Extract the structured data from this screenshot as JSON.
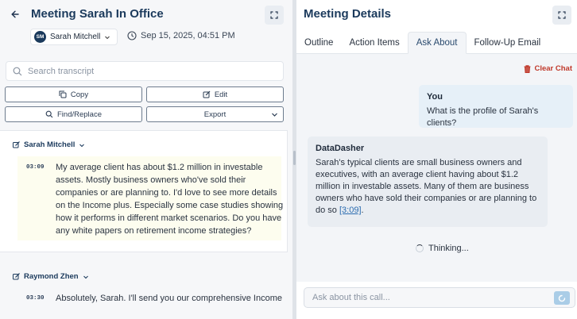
{
  "left": {
    "title": "Meeting Sarah In Office",
    "speaker_initials": "SM",
    "speaker_name": "Sarah Mitchell",
    "date": "Sep 15, 2025, 04:51 PM",
    "search_placeholder": "Search transcript",
    "buttons": {
      "copy": "Copy",
      "edit": "Edit",
      "find_replace": "Find/Replace",
      "export": "Export"
    },
    "entries": [
      {
        "speaker": "Sarah Mitchell",
        "timestamp": "03:09",
        "lines": [
          "My average client has about $1.2 million in investable",
          "assets. Mostly business owners who've sold their",
          "companies or are planning to. I'd love to see more details",
          "on the Income plus. Especially some case studies showing",
          "how it performs in different market scenarios. Do you have",
          "any white papers on retirement income strategies?"
        ]
      },
      {
        "speaker": "Raymond Zhen",
        "timestamp": "03:30",
        "lines": [
          "Absolutely, Sarah. I'll send you our comprehensive Income"
        ]
      }
    ]
  },
  "right": {
    "title": "Meeting Details",
    "tabs": [
      "Outline",
      "Action Items",
      "Ask About",
      "Follow-Up Email"
    ],
    "active_tab": "Ask About",
    "clear_chat": "Clear Chat",
    "user_msg": {
      "author": "You",
      "text": "What is the profile of Sarah's clients?"
    },
    "bot_msg": {
      "author": "DataDasher",
      "text": "Sarah's typical clients are small business owners and executives, with an average client having about $1.2 million in investable assets. Many of them are business owners who have sold their companies or are planning to do so",
      "citation": "[3:09]",
      "after_citation": "."
    },
    "thinking": "Thinking...",
    "input_placeholder": "Ask about this call..."
  },
  "colors": {
    "accent": "#1b3a5c",
    "danger": "#c0392b",
    "highlight": "#fdfdef",
    "link": "#2b6cb0"
  }
}
